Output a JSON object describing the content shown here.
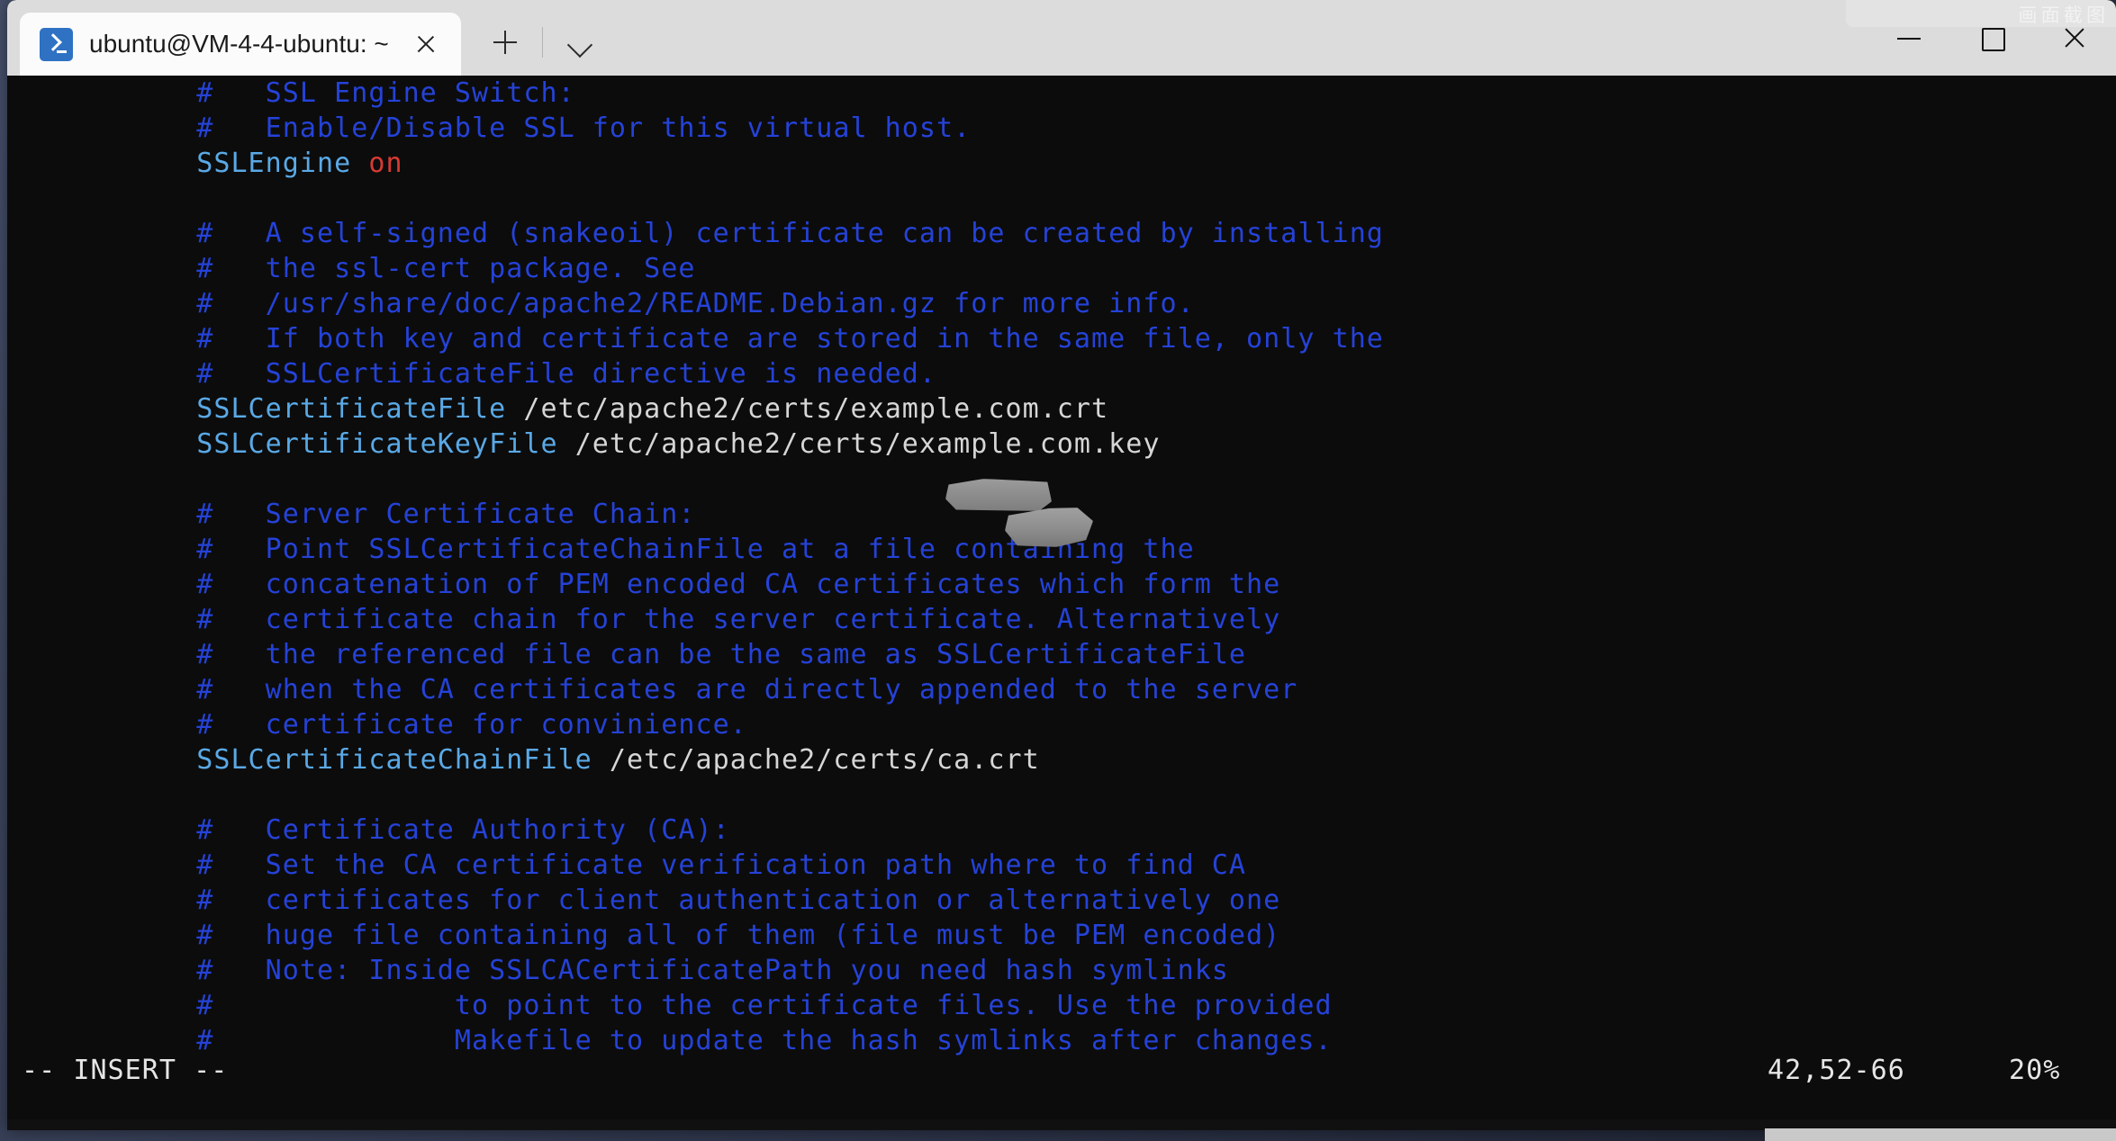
{
  "window": {
    "tab_title": "ubuntu@VM-4-4-ubuntu: ~",
    "tab_icon": "powershell-icon",
    "close_tab_label": "",
    "new_tab_label": "",
    "dropdown_label": "",
    "minimize_label": "",
    "maximize_label": "",
    "close_label": "",
    "watermark_text": "画 面 截 图"
  },
  "terminal": {
    "background": "#0c0c0c",
    "colors": {
      "comment": "#2542d8",
      "directive": "#5aa9e6",
      "value": "#d6d6d6",
      "keyword_on": "#d83a34",
      "status_text": "#e6e6e6"
    },
    "lines": [
      {
        "indent": 11,
        "parts": [
          {
            "t": "#   SSL Engine Switch:",
            "c": "comment"
          }
        ]
      },
      {
        "indent": 11,
        "parts": [
          {
            "t": "#   Enable/Disable SSL for this virtual host.",
            "c": "comment"
          }
        ]
      },
      {
        "indent": 11,
        "parts": [
          {
            "t": "SSLEngine ",
            "c": "key"
          },
          {
            "t": "on",
            "c": "on"
          }
        ]
      },
      {
        "indent": 11,
        "parts": []
      },
      {
        "indent": 11,
        "parts": [
          {
            "t": "#   A self-signed (snakeoil) certificate can be created by installing",
            "c": "comment"
          }
        ]
      },
      {
        "indent": 11,
        "parts": [
          {
            "t": "#   the ssl-cert package. See",
            "c": "comment"
          }
        ]
      },
      {
        "indent": 11,
        "parts": [
          {
            "t": "#   /usr/share/doc/apache2/README.Debian.gz for more info.",
            "c": "comment"
          }
        ]
      },
      {
        "indent": 11,
        "parts": [
          {
            "t": "#   If both key and certificate are stored in the same file, only the",
            "c": "comment"
          }
        ]
      },
      {
        "indent": 11,
        "parts": [
          {
            "t": "#   SSLCertificateFile directive is needed.",
            "c": "comment"
          }
        ]
      },
      {
        "indent": 11,
        "parts": [
          {
            "t": "SSLCertificateFile",
            "c": "key"
          },
          {
            "t": " /etc/apache2/certs/example.com.crt",
            "c": "val"
          }
        ]
      },
      {
        "indent": 11,
        "parts": [
          {
            "t": "SSLCertificateKeyFile",
            "c": "key"
          },
          {
            "t": " /etc/apache2/certs/example.com.key",
            "c": "val"
          }
        ]
      },
      {
        "indent": 11,
        "parts": []
      },
      {
        "indent": 11,
        "parts": [
          {
            "t": "#   Server Certificate Chain:",
            "c": "comment"
          }
        ]
      },
      {
        "indent": 11,
        "parts": [
          {
            "t": "#   Point SSLCertificateChainFile at a file containing the",
            "c": "comment"
          }
        ]
      },
      {
        "indent": 11,
        "parts": [
          {
            "t": "#   concatenation of PEM encoded CA certificates which form the",
            "c": "comment"
          }
        ]
      },
      {
        "indent": 11,
        "parts": [
          {
            "t": "#   certificate chain for the server certificate. Alternatively",
            "c": "comment"
          }
        ]
      },
      {
        "indent": 11,
        "parts": [
          {
            "t": "#   the referenced file can be the same as SSLCertificateFile",
            "c": "comment"
          }
        ]
      },
      {
        "indent": 11,
        "parts": [
          {
            "t": "#   when the CA certificates are directly appended to the server",
            "c": "comment"
          }
        ]
      },
      {
        "indent": 11,
        "parts": [
          {
            "t": "#   certificate for convinience.",
            "c": "comment"
          }
        ]
      },
      {
        "indent": 11,
        "parts": [
          {
            "t": "SSLCertificateChainFile",
            "c": "key"
          },
          {
            "t": " /etc/apache2/certs/ca.crt",
            "c": "val"
          }
        ]
      },
      {
        "indent": 11,
        "parts": []
      },
      {
        "indent": 11,
        "parts": [
          {
            "t": "#   Certificate Authority (CA):",
            "c": "comment"
          }
        ]
      },
      {
        "indent": 11,
        "parts": [
          {
            "t": "#   Set the CA certificate verification path where to find CA",
            "c": "comment"
          }
        ]
      },
      {
        "indent": 11,
        "parts": [
          {
            "t": "#   certificates for client authentication or alternatively one",
            "c": "comment"
          }
        ]
      },
      {
        "indent": 11,
        "parts": [
          {
            "t": "#   huge file containing all of them (file must be PEM encoded)",
            "c": "comment"
          }
        ]
      },
      {
        "indent": 11,
        "parts": [
          {
            "t": "#   Note: Inside SSLCACertificatePath you need hash symlinks",
            "c": "comment"
          }
        ]
      },
      {
        "indent": 11,
        "parts": [
          {
            "t": "#              to point to the certificate files. Use the provided",
            "c": "comment"
          }
        ]
      },
      {
        "indent": 11,
        "parts": [
          {
            "t": "#              Makefile to update the hash symlinks after changes.",
            "c": "comment"
          }
        ]
      }
    ],
    "redactions": [
      {
        "id": "redact1",
        "covers": "domain-name-in-crt-path"
      },
      {
        "id": "redact2",
        "covers": "domain-name-in-key-path"
      }
    ]
  },
  "status": {
    "mode": "-- INSERT --",
    "ruler": "42,52-66",
    "percent": "20%"
  }
}
